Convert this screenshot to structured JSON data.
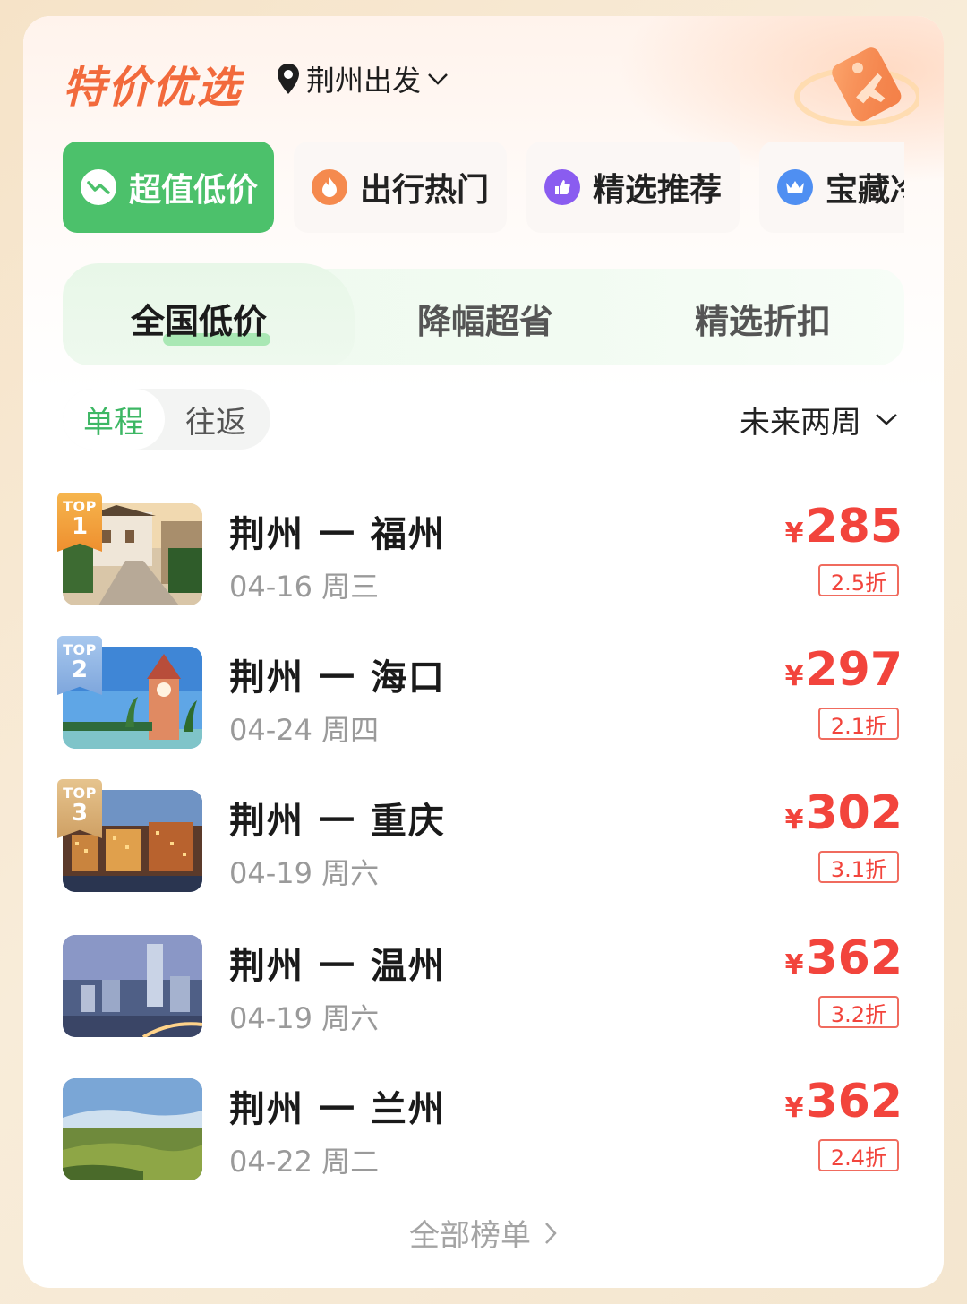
{
  "header": {
    "title": "特价优选",
    "location_label": "荆州出发"
  },
  "categories": [
    {
      "label": "超值低价",
      "icon": "trend-icon",
      "active": true
    },
    {
      "label": "出行热门",
      "icon": "fire-icon",
      "active": false
    },
    {
      "label": "精选推荐",
      "icon": "thumb-up-icon",
      "active": false
    },
    {
      "label": "宝藏冷门",
      "icon": "crown-icon",
      "active": false
    }
  ],
  "subtabs": [
    {
      "label": "全国低价",
      "active": true
    },
    {
      "label": "降幅超省",
      "active": false
    },
    {
      "label": "精选折扣",
      "active": false
    }
  ],
  "trip_types": [
    {
      "label": "单程",
      "active": true
    },
    {
      "label": "往返",
      "active": false
    }
  ],
  "date_range": "未来两周",
  "currency_symbol": "¥",
  "flights": [
    {
      "rank": "1",
      "rank_label": "TOP",
      "route": "荆州 一 福州",
      "date": "04-16 周三",
      "price": "285",
      "discount": "2.5折",
      "scene": "alley-photo"
    },
    {
      "rank": "2",
      "rank_label": "TOP",
      "route": "荆州 一 海口",
      "date": "04-24 周四",
      "price": "297",
      "discount": "2.1折",
      "scene": "clocktower-photo"
    },
    {
      "rank": "3",
      "rank_label": "TOP",
      "route": "荆州 一 重庆",
      "date": "04-19 周六",
      "price": "302",
      "discount": "3.1折",
      "scene": "night-city-photo"
    },
    {
      "rank": "",
      "rank_label": "",
      "route": "荆州 一 温州",
      "date": "04-19 周六",
      "price": "362",
      "discount": "3.2折",
      "scene": "skyline-photo"
    },
    {
      "rank": "",
      "rank_label": "",
      "route": "荆州 一 兰州",
      "date": "04-22 周二",
      "price": "362",
      "discount": "2.4折",
      "scene": "landscape-photo"
    }
  ],
  "footer": {
    "all_list_label": "全部榜单"
  },
  "colors": {
    "title": "#f26a3c",
    "active_green": "#4cc16b",
    "price_red": "#f2443c",
    "rank1": "#f2a13c",
    "rank2": "#8fb7e6",
    "rank3": "#d9b27a"
  }
}
